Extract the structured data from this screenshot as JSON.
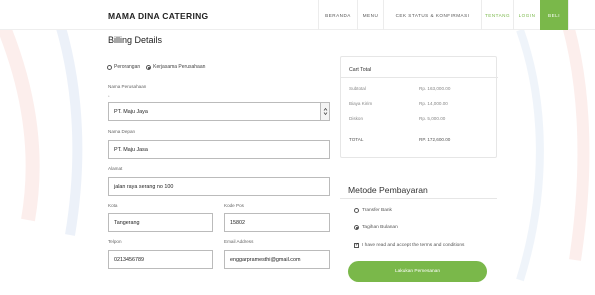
{
  "navbar": {
    "brand": "MAMA DINA CATERING",
    "items": [
      {
        "label": "BERANDA"
      },
      {
        "label": "MENU"
      },
      {
        "label": "CEK STATUS & KONFIRMASI"
      },
      {
        "label": "TENTANG"
      },
      {
        "label": "LOGIN"
      },
      {
        "label": "BELI"
      }
    ]
  },
  "billing": {
    "title": "Billing Details",
    "customer_type": {
      "options": [
        "Perorangan",
        "Kerjasama Perusahaan"
      ],
      "selected": "Kerjasama Perusahaan"
    },
    "company_label": "Nama Perusahaan",
    "company_value": "PT. Maju Jaya",
    "receiver_label": "Nama Depan",
    "receiver_value": "PT. Maju Jasa",
    "address_label": "Alamat",
    "address_value": "jalan raya serang no 100",
    "city_label": "Kota",
    "city_value": "Tangerang",
    "postcode_label": "Kode Pos",
    "postcode_value": "15802",
    "phone_label": "Telpon",
    "phone_value": "0213456789",
    "email_label": "Email Address",
    "email_value": "enggarpramesthi@gmail.com"
  },
  "cart": {
    "title": "Cart Total",
    "rows": [
      {
        "label": "Subtotal",
        "value": "Rp. 163,000.00"
      },
      {
        "label": "Biaya Kirim",
        "value": "Rp. 14,000.00"
      },
      {
        "label": "Diskon",
        "value": "Rp. 5,000.00"
      }
    ],
    "total_label": "TOTAL",
    "total_value": "RP. 172,600.00"
  },
  "payment": {
    "title": "Metode Pembayaran",
    "options": [
      "Transfer Bank",
      "Tagihan Bulanan"
    ],
    "selected": "Tagihan Bulanan",
    "terms_label": "I have read and accept the terms and conditions",
    "terms_checked": true,
    "submit_label": "Lakukan Pemesanan"
  },
  "colors": {
    "accent": "#7ab84a",
    "deco_pink": "#f9dcd8",
    "deco_blue": "#d9e3f3"
  }
}
